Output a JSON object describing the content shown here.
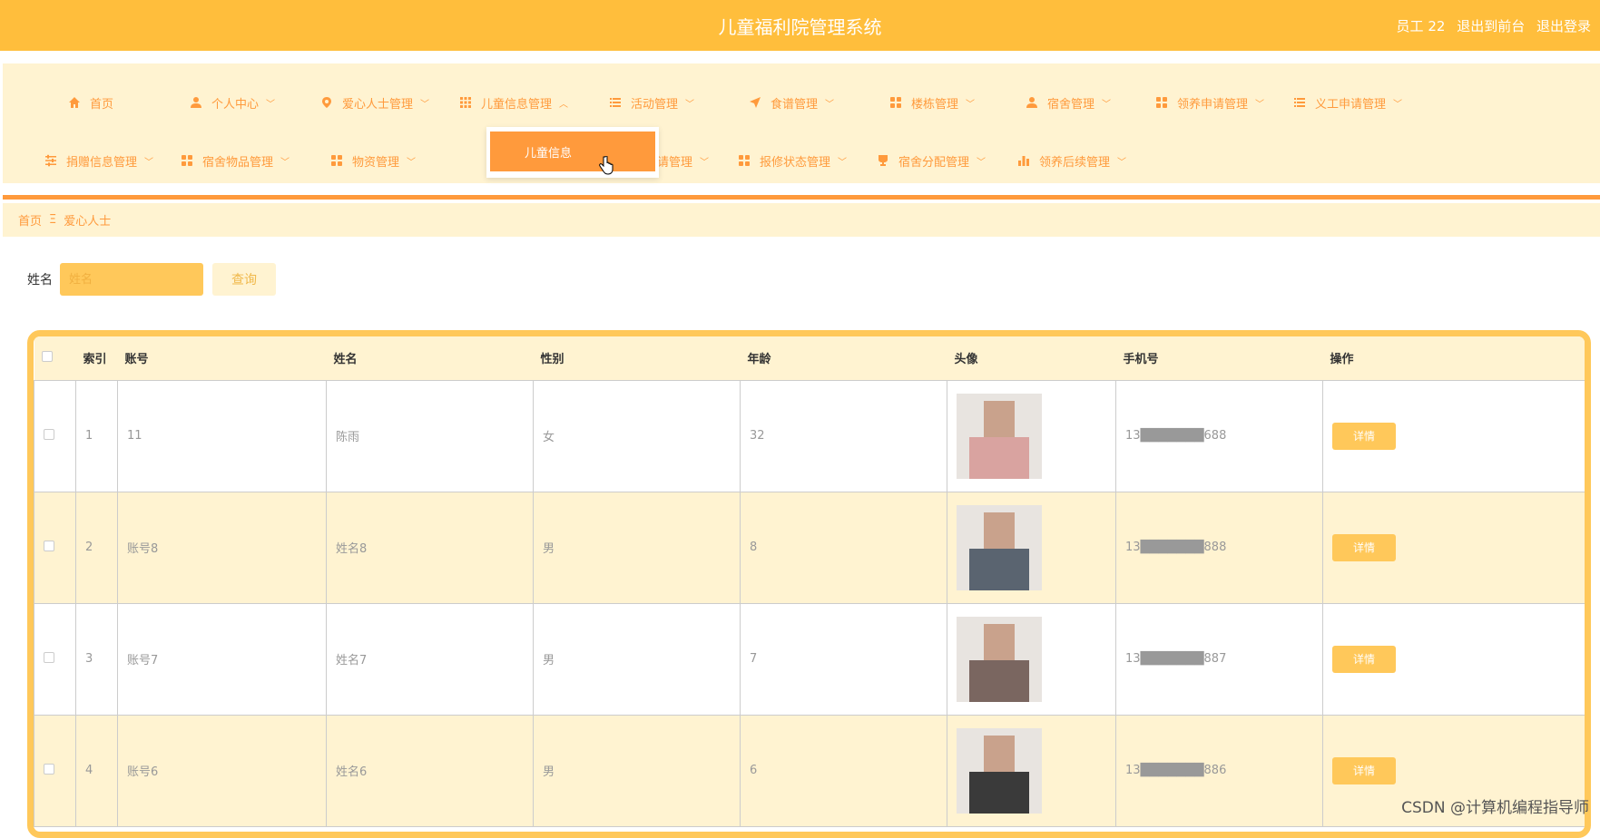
{
  "header": {
    "title": "儿童福利院管理系统",
    "user": "员工 22",
    "to_front": "退出到前台",
    "logout": "退出登录"
  },
  "nav": {
    "row1": [
      {
        "label": "首页",
        "icon": "home-icon",
        "chevron": false
      },
      {
        "label": "个人中心",
        "icon": "user-icon",
        "chevron": true
      },
      {
        "label": "爱心人士管理",
        "icon": "pin-icon",
        "chevron": true
      },
      {
        "label": "儿童信息管理",
        "icon": "grid-icon",
        "chevron": true,
        "expanded": true
      },
      {
        "label": "活动管理",
        "icon": "list-icon",
        "chevron": true
      },
      {
        "label": "食谱管理",
        "icon": "send-icon",
        "chevron": true
      },
      {
        "label": "楼栋管理",
        "icon": "apps-icon",
        "chevron": true
      },
      {
        "label": "宿舍管理",
        "icon": "user-icon",
        "chevron": true
      },
      {
        "label": "领养申请管理",
        "icon": "apps-icon",
        "chevron": true
      },
      {
        "label": "义工申请管理",
        "icon": "list-icon",
        "chevron": true
      }
    ],
    "row2": [
      {
        "label": "捐赠信息管理",
        "icon": "sliders-icon",
        "chevron": true
      },
      {
        "label": "宿舍物品管理",
        "icon": "apps-icon",
        "chevron": true
      },
      {
        "label": "物资管理",
        "icon": "apps-icon",
        "chevron": true
      },
      {
        "label": "报修申请管理",
        "icon": "apps-icon",
        "chevron": true
      },
      {
        "label": "报修状态管理",
        "icon": "apps-icon",
        "chevron": true
      },
      {
        "label": "宿舍分配管理",
        "icon": "trophy-icon",
        "chevron": true
      },
      {
        "label": "领养后续管理",
        "icon": "bar-chart-icon",
        "chevron": true
      }
    ],
    "dropdown_item": "儿童信息"
  },
  "breadcrumb": {
    "home": "首页",
    "separator": "Ξ",
    "current": "爱心人士"
  },
  "search": {
    "label": "姓名",
    "placeholder": "姓名",
    "button": "查询"
  },
  "table": {
    "headers": [
      "索引",
      "账号",
      "姓名",
      "性别",
      "年龄",
      "头像",
      "手机号",
      "操作"
    ],
    "rows": [
      {
        "index": "1",
        "account": "11",
        "name": "陈雨",
        "gender": "女",
        "age": "32",
        "phone": "13███████688",
        "action": "详情",
        "avatar_color": "#d9a3a0"
      },
      {
        "index": "2",
        "account": "账号8",
        "name": "姓名8",
        "gender": "男",
        "age": "8",
        "phone": "13███████888",
        "action": "详情",
        "avatar_color": "#5a6470"
      },
      {
        "index": "3",
        "account": "账号7",
        "name": "姓名7",
        "gender": "男",
        "age": "7",
        "phone": "13███████887",
        "action": "详情",
        "avatar_color": "#7a6660"
      },
      {
        "index": "4",
        "account": "账号6",
        "name": "姓名6",
        "gender": "男",
        "age": "6",
        "phone": "13███████886",
        "action": "详情",
        "avatar_color": "#3a3a3a"
      }
    ]
  },
  "watermark": "CSDN @计算机编程指导师",
  "colors": {
    "topbar": "#ffbe3c",
    "accent": "#ff9a3c",
    "nav_bg": "#fff3d1",
    "input_bg": "#ffc85a"
  }
}
